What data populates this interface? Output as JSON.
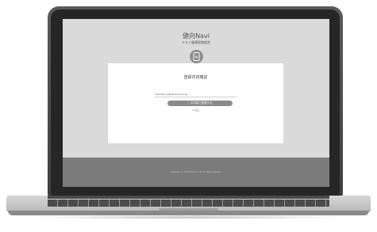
{
  "site": {
    "brand": "健向Navi",
    "subtitle": "テスト健康保険組合"
  },
  "card": {
    "title": "登録内容確認",
    "email": "xxxxxxxx_k@xxxxxx-s.co.jp",
    "register_button": "この内容で登録する",
    "back_link": "< 戻る"
  },
  "footer": {
    "copyright": "Copyright (c) XXXXXXXX Co., Ltd. All rights reserved."
  },
  "icons": {
    "logo": "smartphone-health-icon"
  }
}
